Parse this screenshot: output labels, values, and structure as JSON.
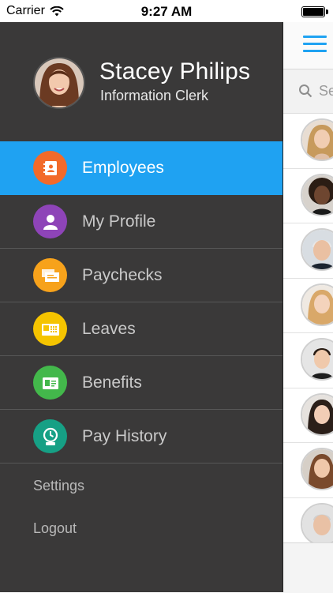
{
  "status_bar": {
    "carrier": "Carrier",
    "time": "9:27 AM"
  },
  "profile": {
    "name": "Stacey Philips",
    "role": "Information Clerk"
  },
  "menu": [
    {
      "label": "Employees",
      "icon": "address-book-icon",
      "color": "#f26a2a",
      "active": true
    },
    {
      "label": "My Profile",
      "icon": "person-icon",
      "color": "#8e44b8",
      "active": false
    },
    {
      "label": "Paychecks",
      "icon": "paychecks-icon",
      "color": "#f7a21b",
      "active": false
    },
    {
      "label": "Leaves",
      "icon": "calendar-icon",
      "color": "#f5c400",
      "active": false
    },
    {
      "label": "Benefits",
      "icon": "id-card-icon",
      "color": "#43b84b",
      "active": false
    },
    {
      "label": "Pay History",
      "icon": "clock-icon",
      "color": "#16a085",
      "active": false
    }
  ],
  "secondary": {
    "settings": "Settings",
    "logout": "Logout"
  },
  "search": {
    "placeholder": "Se"
  },
  "colors": {
    "accent": "#1fa2f2",
    "drawer_bg": "#3a3939"
  }
}
